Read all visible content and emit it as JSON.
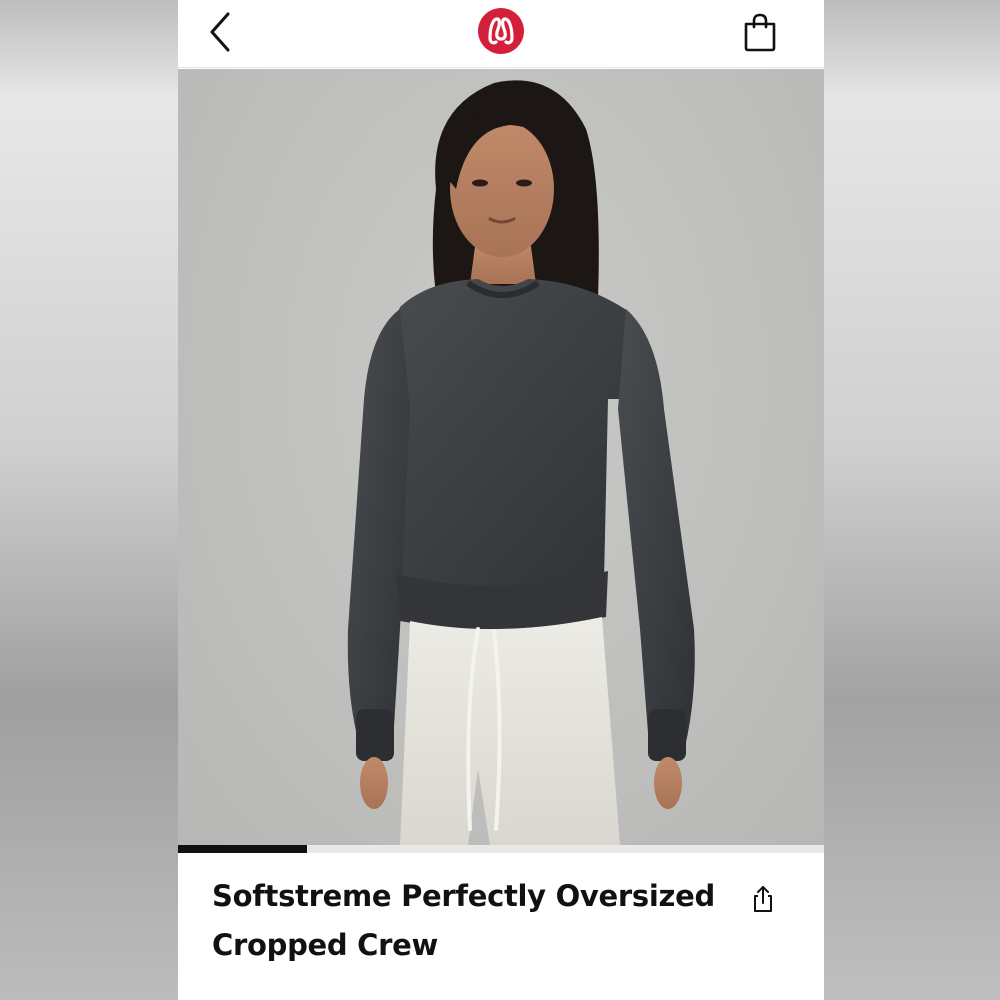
{
  "topbar": {
    "back_icon": "chevron-left-icon",
    "logo_icon": "lululemon-logo",
    "bag_icon": "shopping-bag-icon",
    "brand_color": "#d31f3a"
  },
  "gallery": {
    "image_alt": "Softstreme Perfectly Oversized Cropped Crew",
    "progress": 0.2
  },
  "product": {
    "title": "Softstreme Perfectly Oversized Cropped Crew",
    "share_icon": "share-icon"
  }
}
